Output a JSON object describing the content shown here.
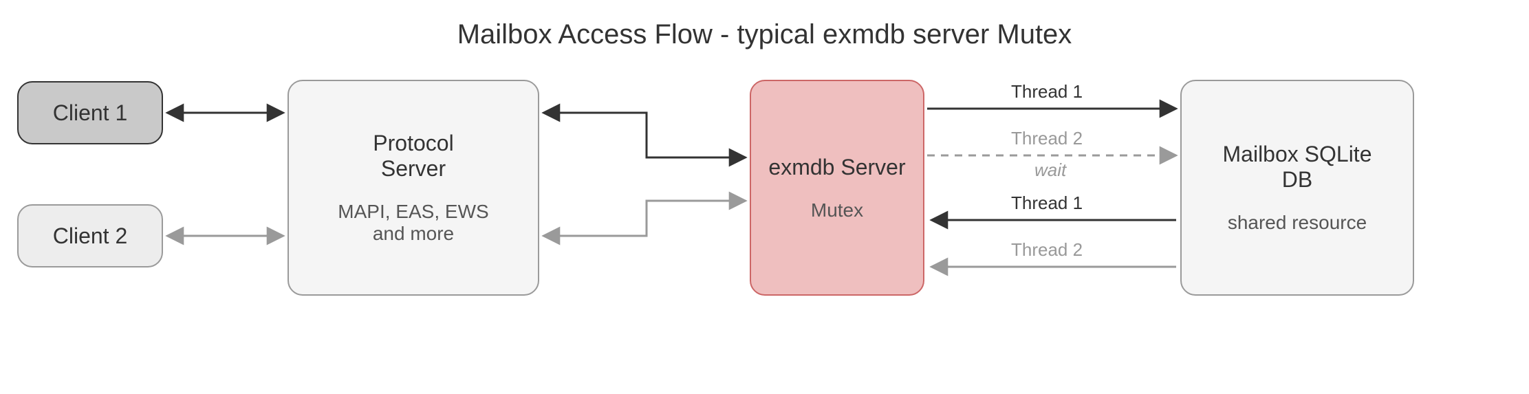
{
  "title": "Mailbox Access Flow - typical exmdb server Mutex",
  "nodes": {
    "client1": {
      "label": "Client 1"
    },
    "client2": {
      "label": "Client 2"
    },
    "protocol": {
      "line1": "Protocol Server",
      "line2": "MAPI, EAS, EWS and more"
    },
    "exmdb": {
      "line1": "exmdb Server",
      "line2": "Mutex"
    },
    "mailbox": {
      "line1": "Mailbox SQLite DB",
      "line2": "shared resource"
    }
  },
  "edges": {
    "client1_protocol": {
      "style": "solid-black",
      "bidir": true
    },
    "client2_protocol": {
      "style": "solid-grey",
      "bidir": true
    },
    "protocol_exmdb_top": {
      "style": "solid-black",
      "bidir": true
    },
    "protocol_exmdb_bottom": {
      "style": "solid-grey",
      "bidir": true
    },
    "exmdb_mailbox_1": {
      "label": "Thread 1",
      "style": "solid-black",
      "dir": "right"
    },
    "exmdb_mailbox_2": {
      "label": "Thread 2",
      "sublabel": "wait",
      "style": "dashed-grey",
      "dir": "right"
    },
    "mailbox_exmdb_3": {
      "label": "Thread 1",
      "style": "solid-black",
      "dir": "left"
    },
    "mailbox_exmdb_4": {
      "label": "Thread 2",
      "style": "solid-grey",
      "dir": "left"
    }
  },
  "colors": {
    "black": "#333333",
    "grey": "#9a9a9a",
    "exmdb_fill": "#efbfbf",
    "exmdb_border": "#cc6666",
    "node_fill": "#f5f5f5",
    "client1_fill": "#c9c9c9",
    "client2_fill": "#ededed"
  }
}
